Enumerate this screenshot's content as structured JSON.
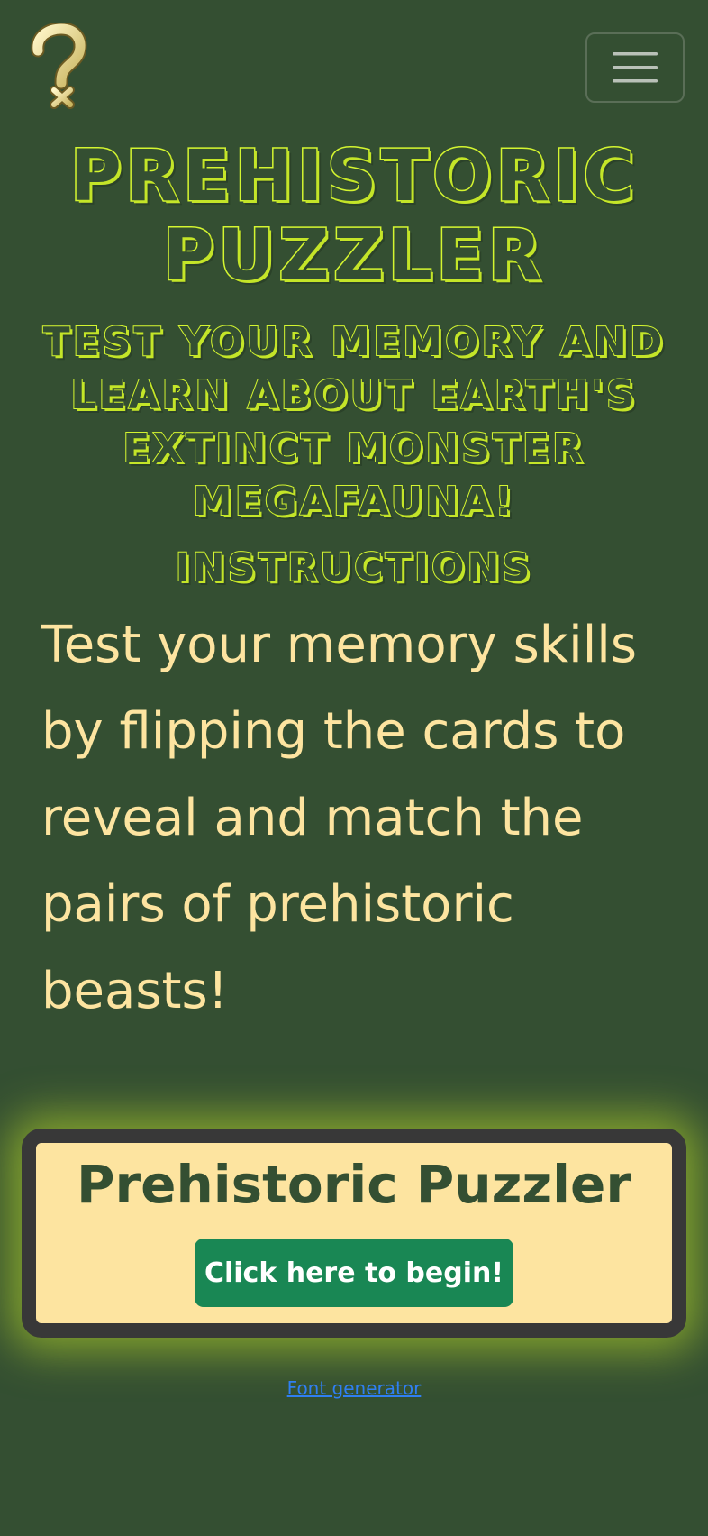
{
  "header": {
    "logo_icon": "question-mark-icon",
    "menu_icon": "hamburger-menu-icon"
  },
  "hero": {
    "title": "Prehistoric Puzzler",
    "subtitle": "Test your memory and learn about Earth's extinct monster megafauna!"
  },
  "instructions": {
    "heading": "Instructions",
    "text": "Test your memory skills by flipping the cards to reveal and match the pairs of prehistoric beasts!"
  },
  "start_card": {
    "title": "Prehistoric Puzzler",
    "button_label": "Click here to begin!"
  },
  "footer": {
    "link_text": "Font generator"
  },
  "colors": {
    "background": "#344f32",
    "title_accent": "#d4f530",
    "body_text": "#fde4a0",
    "card_background": "#fde4a0",
    "card_border": "#383838",
    "button": "#198754",
    "link": "#2f7ff2"
  }
}
